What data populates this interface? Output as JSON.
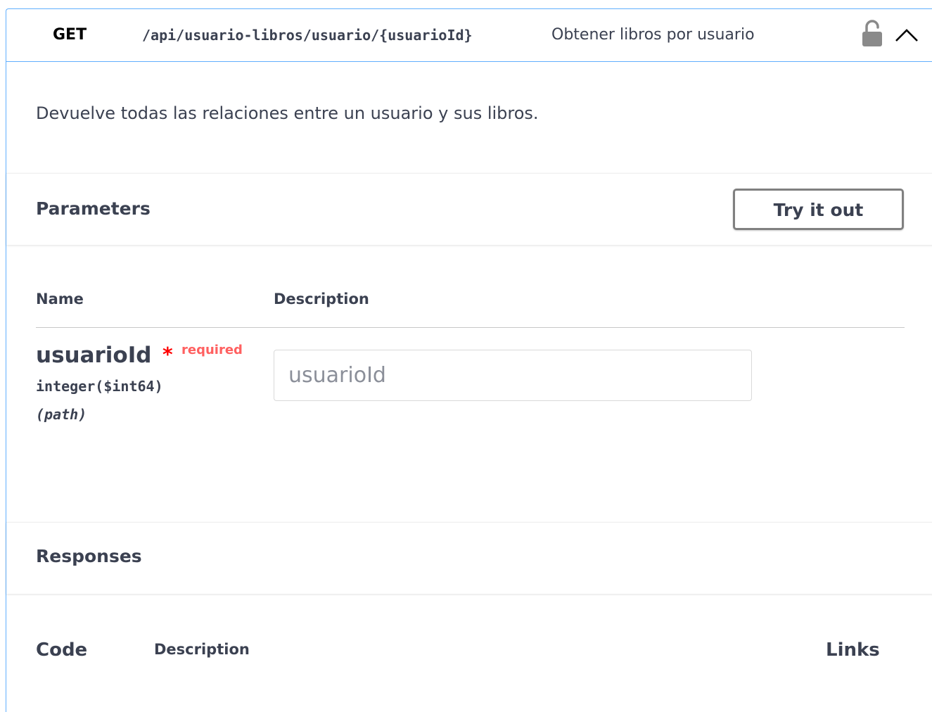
{
  "operation": {
    "method": "GET",
    "path": "/api/usuario-libros/usuario/{usuarioId}",
    "summary": "Obtener libros por usuario",
    "description": "Devuelve todas las relaciones entre un usuario y sus libros.",
    "lock_icon": "unlocked-lock-icon",
    "collapse_icon": "chevron-up-icon",
    "method_color": "#61affe"
  },
  "parameters": {
    "title": "Parameters",
    "try_button_label": "Try it out",
    "columns": {
      "name": "Name",
      "description": "Description"
    },
    "items": [
      {
        "name": "usuarioId",
        "required_mark": "*",
        "required_label": "required",
        "type": "integer($int64)",
        "location": "(path)",
        "input_placeholder": "usuarioId",
        "input_value": ""
      }
    ]
  },
  "responses": {
    "title": "Responses",
    "columns": {
      "code": "Code",
      "description": "Description",
      "links": "Links"
    }
  }
}
